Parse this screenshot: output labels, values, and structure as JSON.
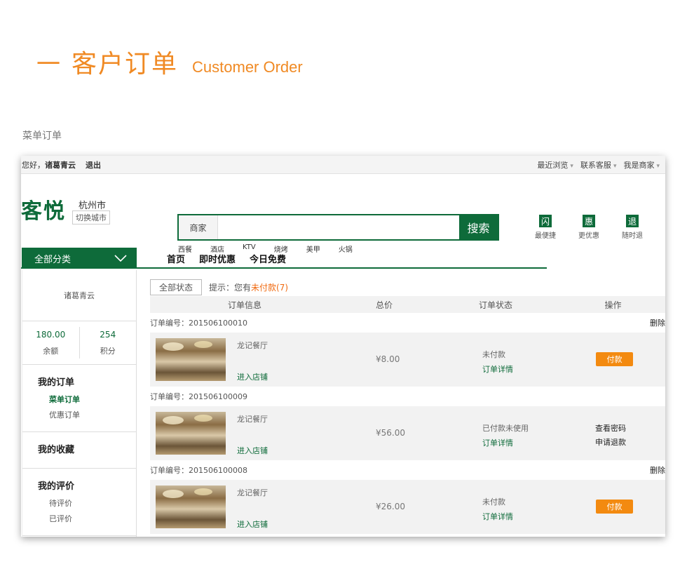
{
  "heading": {
    "dash": "一",
    "title_cn": "客户订单",
    "title_en": "Customer Order"
  },
  "section_label": "菜单订单",
  "topbar": {
    "greeting": "您好，",
    "username": "诸葛青云",
    "logout": "退出",
    "links": [
      "最近浏览",
      "联系客服",
      "我是商家"
    ]
  },
  "brand": {
    "logo": "客悦",
    "city": "杭州市",
    "switch_city": "切换城市"
  },
  "search": {
    "type": "商家",
    "placeholder": "",
    "button": "搜索",
    "tags": [
      "西餐",
      "酒店",
      "KTV",
      "烧烤",
      "美甲",
      "火锅"
    ]
  },
  "promises": [
    {
      "badge": "闪",
      "label": "最便捷"
    },
    {
      "badge": "惠",
      "label": "更优惠"
    },
    {
      "badge": "退",
      "label": "随时退"
    }
  ],
  "nav": {
    "all_categories": "全部分类",
    "tabs": [
      "首页",
      "即时优惠",
      "今日免费"
    ]
  },
  "sidebar": {
    "user": "诸葛青云",
    "balance_value": "180.00",
    "balance_label": "余额",
    "points_value": "254",
    "points_label": "积分",
    "my_orders": "我的订单",
    "menu_orders": "菜单订单",
    "coupon_orders": "优惠订单",
    "favorites": "我的收藏",
    "reviews": "我的评价",
    "pending_review": "待评价",
    "reviewed": "已评价"
  },
  "filter": {
    "all_status": "全部状态",
    "tip_prefix": "提示：您有",
    "tip_highlight": "未付款(7)"
  },
  "columns": [
    "订单信息",
    "总价",
    "订单状态",
    "操作"
  ],
  "orders": [
    {
      "no": "订单编号：201506100010",
      "delete": "删除",
      "restaurant": "龙记餐厅",
      "enter": "进入店铺",
      "price": "¥8.00",
      "status": "未付款",
      "detail": "订单详情",
      "action": "付款"
    },
    {
      "no": "订单编号：201506100009",
      "delete": "",
      "restaurant": "龙记餐厅",
      "enter": "进入店铺",
      "price": "¥56.00",
      "status": "已付款未使用",
      "detail": "订单详情",
      "op1": "查看密码",
      "op2": "申请退款"
    },
    {
      "no": "订单编号：201506100008",
      "delete": "删除",
      "restaurant": "龙记餐厅",
      "enter": "进入店铺",
      "price": "¥26.00",
      "status": "未付款",
      "detail": "订单详情",
      "action": "付款"
    }
  ],
  "colors": {
    "brand_green": "#0e6b3a",
    "accent_orange": "#f08a24",
    "pay_orange": "#f38a10"
  }
}
